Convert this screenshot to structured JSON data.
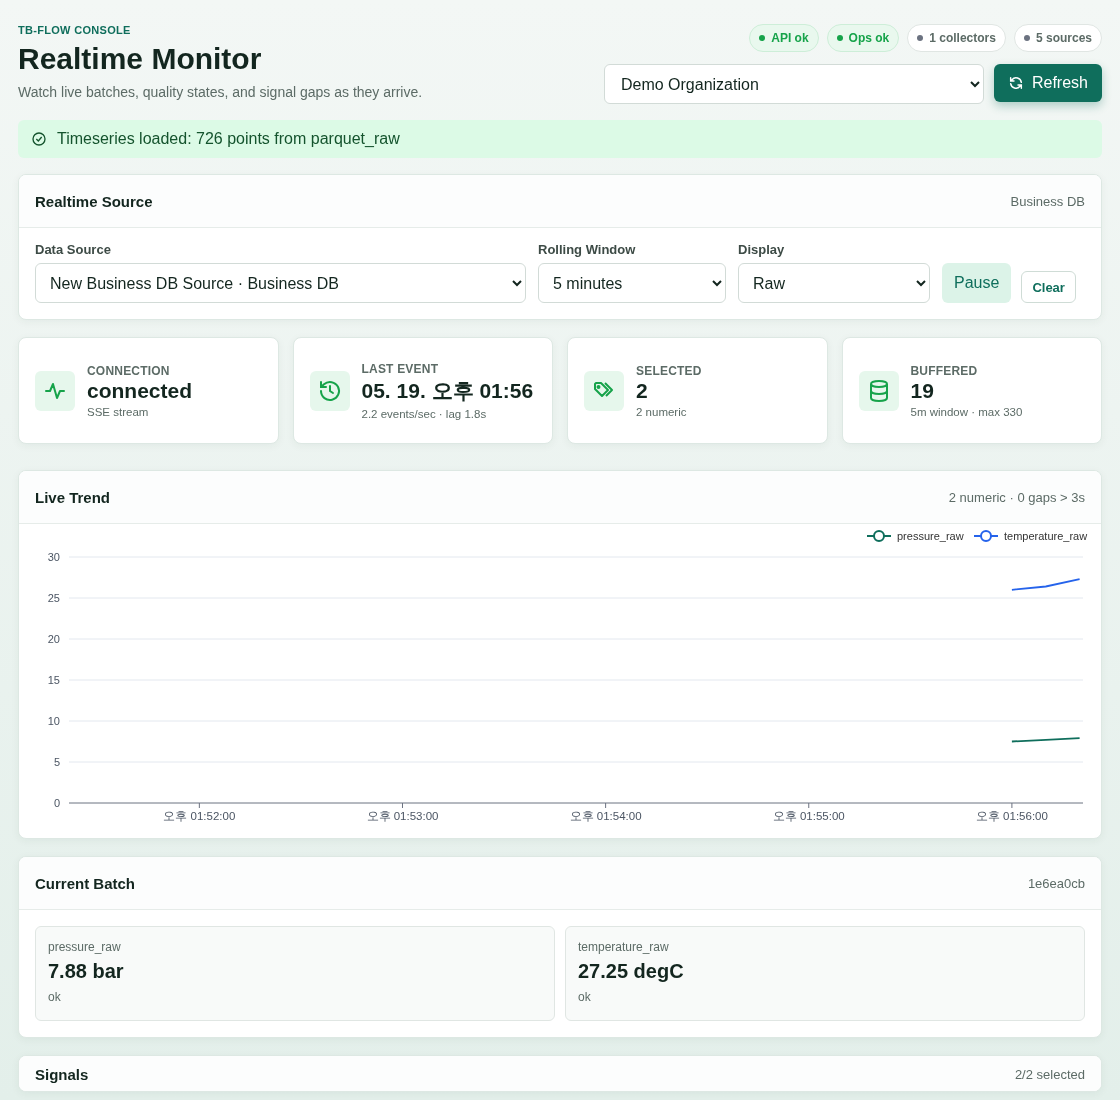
{
  "header": {
    "eyebrow": "TB-FLOW CONSOLE",
    "title": "Realtime Monitor",
    "subtitle": "Watch live batches, quality states, and signal gaps as they arrive.",
    "pills": [
      {
        "label": "API ok",
        "ok": true
      },
      {
        "label": "Ops ok",
        "ok": true
      },
      {
        "label": "1 collectors",
        "ok": false
      },
      {
        "label": "5 sources",
        "ok": false
      }
    ],
    "organization": "Demo Organization",
    "refresh_button": "Refresh"
  },
  "notice": "Timeseries loaded: 726 points from parquet_raw",
  "source": {
    "title": "Realtime Source",
    "meta": "Business DB",
    "fields": [
      {
        "label": "Data Source",
        "value": "New Business DB Source · Business DB"
      },
      {
        "label": "Rolling Window",
        "value": "5 minutes"
      },
      {
        "label": "Display",
        "value": "Raw"
      }
    ],
    "pause_button": "Pause",
    "clear_button": "Clear"
  },
  "stats": [
    {
      "kind": "pulse",
      "label": "CONNECTION",
      "value": "connected",
      "detail": "SSE stream"
    },
    {
      "kind": "history",
      "label": "LAST EVENT",
      "value": "05. 19. 오후 01:56",
      "detail": "2.2 events/sec · lag 1.8s"
    },
    {
      "kind": "tags",
      "label": "SELECTED",
      "value": "2",
      "detail": "2 numeric"
    },
    {
      "kind": "database",
      "label": "BUFFERED",
      "value": "19",
      "detail": "5m window · max 330"
    }
  ],
  "trend": {
    "title": "Live Trend",
    "meta": "2 numeric · 0 gaps > 3s",
    "chart_data": {
      "type": "line",
      "categories": [
        null,
        null,
        null,
        "오후 01:52:00",
        null,
        null,
        null,
        null,
        null,
        "오후 01:53:00",
        null,
        null,
        null,
        null,
        null,
        "오후 01:54:00",
        null,
        null,
        null,
        null,
        null,
        "오후 01:55:00",
        null,
        null,
        null,
        null,
        null,
        "오후 01:56:00",
        null,
        null
      ],
      "series": [
        {
          "name": "pressure_raw",
          "color": "#0f6e5c",
          "values": [
            null,
            null,
            null,
            null,
            null,
            null,
            null,
            null,
            null,
            null,
            null,
            null,
            null,
            null,
            null,
            null,
            null,
            null,
            null,
            null,
            null,
            null,
            null,
            null,
            null,
            null,
            null,
            7.5,
            7.7,
            7.9
          ]
        },
        {
          "name": "temperature_raw",
          "color": "#2563eb",
          "values": [
            null,
            null,
            null,
            null,
            null,
            null,
            null,
            null,
            null,
            null,
            null,
            null,
            null,
            null,
            null,
            null,
            null,
            null,
            null,
            null,
            null,
            null,
            null,
            null,
            null,
            null,
            null,
            26.0,
            26.4,
            27.3
          ]
        }
      ],
      "ylim": [
        0,
        30
      ],
      "yticks": [
        0,
        5,
        10,
        15,
        20,
        25,
        30
      ],
      "grid": true,
      "legend": "top-right"
    }
  },
  "batch": {
    "title": "Current Batch",
    "meta": "1e6ea0cb",
    "items": [
      {
        "name": "pressure_raw",
        "value": "7.88 bar",
        "note": "ok"
      },
      {
        "name": "temperature_raw",
        "value": "27.25 degC",
        "note": "ok"
      }
    ]
  },
  "signals": {
    "title": "Signals",
    "meta": "2/2 selected"
  }
}
